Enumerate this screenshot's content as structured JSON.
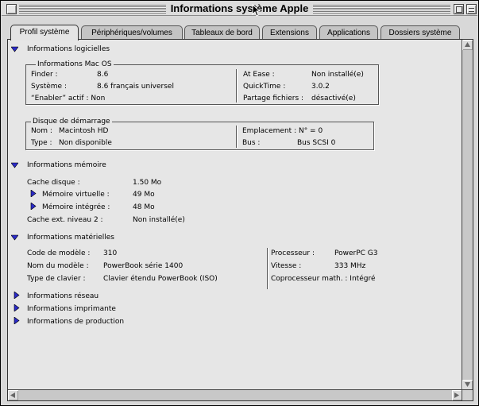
{
  "window": {
    "title": "Informations système Apple"
  },
  "tabs": [
    {
      "label": "Profil système",
      "active": true
    },
    {
      "label": "Périphériques/volumes",
      "active": false
    },
    {
      "label": "Tableaux de bord",
      "active": false
    },
    {
      "label": "Extensions",
      "active": false
    },
    {
      "label": "Applications",
      "active": false
    },
    {
      "label": "Dossiers système",
      "active": false
    }
  ],
  "software": {
    "heading": "Informations logicielles",
    "macos": {
      "title": "Informations Mac OS",
      "finder_label": "Finder :",
      "finder_value": "8.6",
      "system_label": "Système :",
      "system_value": "8.6  français universel",
      "enabler": "“Enabler” actif : Non",
      "atease_label": "At Ease :",
      "atease_value": "Non installé(e)",
      "quicktime_label": "QuickTime :",
      "quicktime_value": "3.0.2",
      "filesharing_label": "Partage fichiers :",
      "filesharing_value": "désactivé(e)"
    },
    "startup": {
      "title": "Disque de démarrage",
      "name_label": "Nom :",
      "name_value": "Macintosh HD",
      "type_label": "Type :",
      "type_value": "Non disponible",
      "location": "Emplacement : N° = 0",
      "bus_label": "Bus :",
      "bus_value": "Bus SCSI 0"
    }
  },
  "memory": {
    "heading": "Informations mémoire",
    "cache_label": "Cache disque :",
    "cache_value": "1.50 Mo",
    "virtual_label": "Mémoire virtuelle :",
    "virtual_value": "49 Mo",
    "builtin_label": "Mémoire intégrée :",
    "builtin_value": "48 Mo",
    "l2_label": "Cache ext. niveau 2 :",
    "l2_value": "Non installé(e)"
  },
  "hardware": {
    "heading": "Informations matérielles",
    "model_code_label": "Code de modèle :",
    "model_code_value": "310",
    "model_name_label": "Nom du modèle :",
    "model_name_value": "PowerBook série 1400",
    "keyboard_label": "Type de clavier :",
    "keyboard_value": "Clavier étendu PowerBook (ISO)",
    "processor_label": "Processeur :",
    "processor_value": "PowerPC G3",
    "speed_label": "Vitesse :",
    "speed_value": "333 MHz",
    "fpu": "Coprocesseur math. : Intégré"
  },
  "collapsed_sections": [
    {
      "label": "Informations réseau"
    },
    {
      "label": "Informations imprimante"
    },
    {
      "label": "Informations de production"
    }
  ],
  "colors": {
    "disclosure": "#2a2ac8",
    "panel": "#e6e6e6",
    "chrome": "#d8d8d8"
  },
  "icons": [
    "close-box-icon",
    "zoom-box-icon",
    "collapse-box-icon",
    "arrow-cursor-icon",
    "disclosure-triangle-icon",
    "scroll-arrow-icon"
  ]
}
